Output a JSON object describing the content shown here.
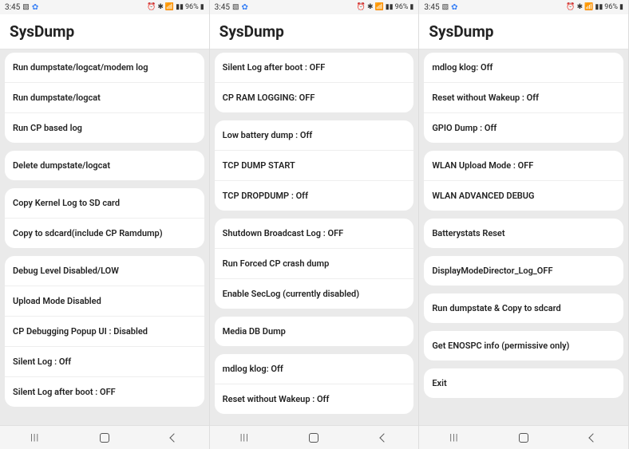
{
  "status": {
    "time": "3:45",
    "battery": "96%",
    "icons_left": [
      "🖼",
      "⚙"
    ],
    "icons_right": [
      "⏰",
      "✱",
      "📶",
      "📶",
      "📶"
    ]
  },
  "title": "SysDump",
  "screens": [
    {
      "groups": [
        [
          "Run dumpstate/logcat/modem log",
          "Run dumpstate/logcat",
          "Run CP based log"
        ],
        [
          "Delete dumpstate/logcat"
        ],
        [
          "Copy Kernel Log to SD card",
          "Copy to sdcard(include CP Ramdump)"
        ],
        [
          "Debug Level Disabled/LOW",
          "Upload Mode Disabled",
          "CP Debugging Popup UI : Disabled",
          "Silent Log : Off",
          "Silent Log after boot : OFF"
        ]
      ]
    },
    {
      "groups": [
        [
          "Silent Log after boot : OFF",
          "CP RAM LOGGING: OFF"
        ],
        [
          "Low battery dump : Off",
          "TCP DUMP START",
          "TCP DROPDUMP : Off"
        ],
        [
          "Shutdown Broadcast Log : OFF",
          "Run Forced CP crash dump",
          "Enable SecLog (currently disabled)"
        ],
        [
          "Media DB Dump"
        ],
        [
          "mdlog klog: Off",
          "Reset without Wakeup : Off"
        ]
      ]
    },
    {
      "groups": [
        [
          "mdlog klog: Off",
          "Reset without Wakeup : Off",
          "GPIO Dump : Off"
        ],
        [
          "WLAN Upload Mode : OFF",
          "WLAN ADVANCED DEBUG"
        ],
        [
          "Batterystats Reset"
        ],
        [
          "DisplayModeDirector_Log_OFF"
        ],
        [
          "Run dumpstate & Copy to sdcard"
        ],
        [
          "Get ENOSPC info (permissive only)"
        ],
        [
          "Exit"
        ]
      ]
    }
  ],
  "nav": {
    "recents": "|||",
    "home": "home",
    "back": "back"
  }
}
